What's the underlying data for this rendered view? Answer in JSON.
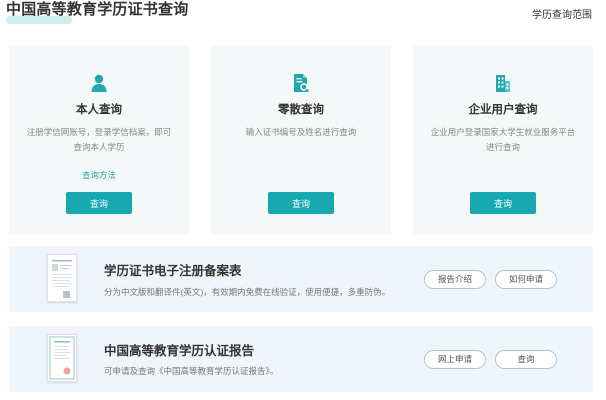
{
  "header": {
    "title": "中国高等教育学历证书查询",
    "scope_link": "学历查询范围"
  },
  "cards": [
    {
      "icon": "person-icon",
      "title": "本人查询",
      "desc": "注册学信网账号，登录学信档案，即可查询本人学历",
      "method": "查询方法",
      "button": "查询"
    },
    {
      "icon": "document-search-icon",
      "title": "零散查询",
      "desc": "输入证书编号及姓名进行查询",
      "method": "",
      "button": "查询"
    },
    {
      "icon": "building-icon",
      "title": "企业用户查询",
      "desc": "企业用户登录国家大学生就业服务平台进行查询",
      "method": "",
      "button": "查询"
    }
  ],
  "rows": [
    {
      "title": "学历证书电子注册备案表",
      "desc": "分为中文版和翻译件(英文)，有效期内免费在线验证，使用便捷，多重防伪。",
      "buttons": [
        "报告介绍",
        "如何申请"
      ]
    },
    {
      "title": "中国高等教育学历认证报告",
      "desc": "可申请及查询《中国高等教育学历认证报告》。",
      "buttons": [
        "网上申请",
        "查询"
      ]
    }
  ],
  "colors": {
    "accent": "#17a8b0",
    "card_bg": "#f5f8f8",
    "row_bg": "#f0f4fb"
  }
}
